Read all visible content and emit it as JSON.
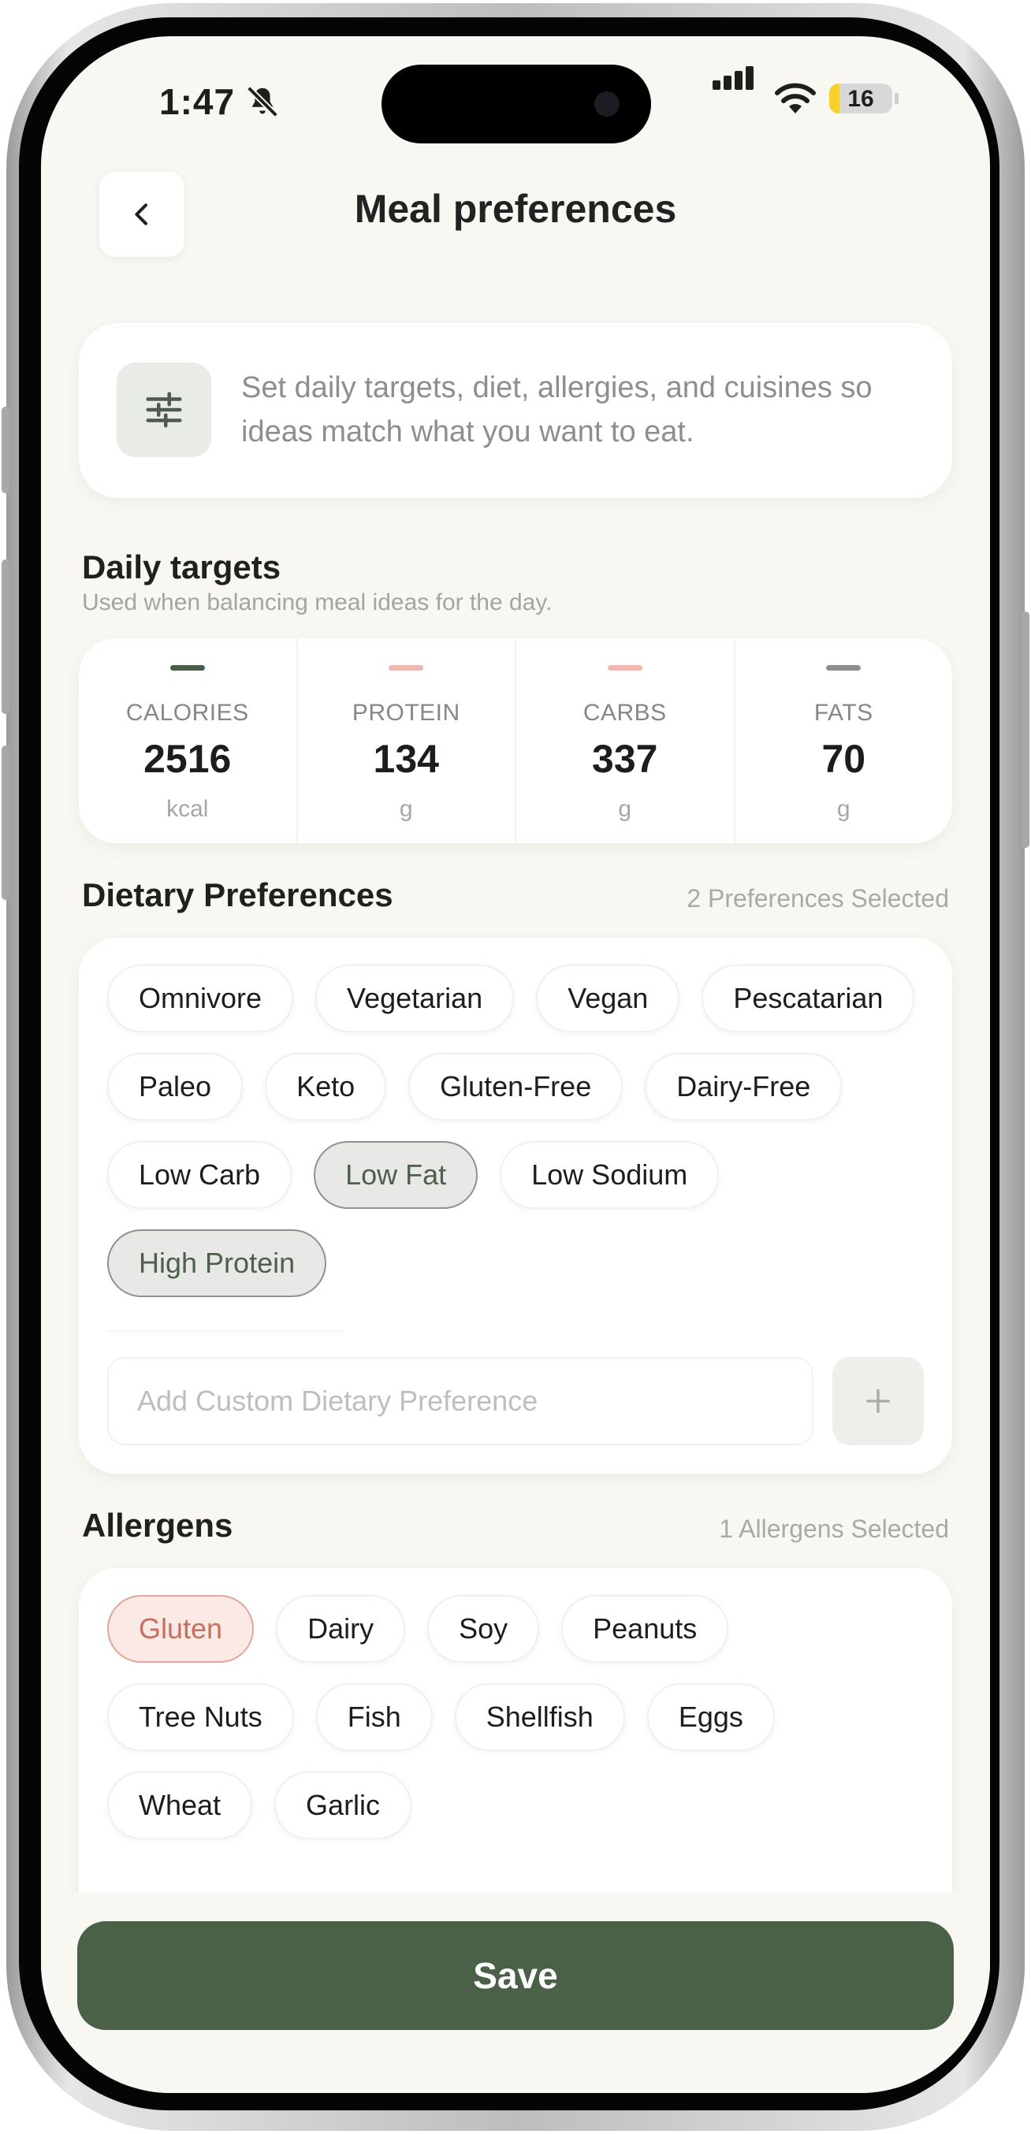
{
  "status_bar": {
    "time": "1:47",
    "battery": "16",
    "battery_level_percent": 16
  },
  "header": {
    "title": "Meal preferences",
    "back_icon": "chevron-left-icon"
  },
  "intro": {
    "icon": "sliders-icon",
    "text": "Set daily targets, diet, allergies, and cuisines so ideas match what you want to eat."
  },
  "daily_targets": {
    "title": "Daily targets",
    "subtitle": "Used when balancing meal ideas for the day.",
    "items": [
      {
        "label": "CALORIES",
        "value": "2516",
        "unit": "kcal",
        "color": "#4b5e49"
      },
      {
        "label": "PROTEIN",
        "value": "134",
        "unit": "g",
        "color": "#f1b8b3"
      },
      {
        "label": "CARBS",
        "value": "337",
        "unit": "g",
        "color": "#f1b8b3"
      },
      {
        "label": "FATS",
        "value": "70",
        "unit": "g",
        "color": "#8d8f8c"
      }
    ]
  },
  "dietary": {
    "title": "Dietary Preferences",
    "count": "2 Preferences Selected",
    "chips": [
      {
        "label": "Omnivore",
        "selected": false
      },
      {
        "label": "Vegetarian",
        "selected": false
      },
      {
        "label": "Vegan",
        "selected": false
      },
      {
        "label": "Pescatarian",
        "selected": false
      },
      {
        "label": "Paleo",
        "selected": false
      },
      {
        "label": "Keto",
        "selected": false
      },
      {
        "label": "Gluten-Free",
        "selected": false
      },
      {
        "label": "Dairy-Free",
        "selected": false
      },
      {
        "label": "Low Carb",
        "selected": false
      },
      {
        "label": "Low Fat",
        "selected": true
      },
      {
        "label": "Low Sodium",
        "selected": false
      },
      {
        "label": "High Protein",
        "selected": true
      }
    ],
    "custom_placeholder": "Add Custom Dietary Preference",
    "custom_value": ""
  },
  "allergens": {
    "title": "Allergens",
    "count": "1 Allergens Selected",
    "chips": [
      {
        "label": "Gluten",
        "selected": true
      },
      {
        "label": "Dairy",
        "selected": false
      },
      {
        "label": "Soy",
        "selected": false
      },
      {
        "label": "Peanuts",
        "selected": false
      },
      {
        "label": "Tree Nuts",
        "selected": false
      },
      {
        "label": "Fish",
        "selected": false
      },
      {
        "label": "Shellfish",
        "selected": false
      },
      {
        "label": "Eggs",
        "selected": false
      },
      {
        "label": "Wheat",
        "selected": false
      },
      {
        "label": "Garlic",
        "selected": false
      }
    ]
  },
  "footer": {
    "save_label": "Save"
  },
  "colors": {
    "accent": "#4a6148",
    "background": "#f8f7f2",
    "allergen_selected": "#c56f5e"
  }
}
